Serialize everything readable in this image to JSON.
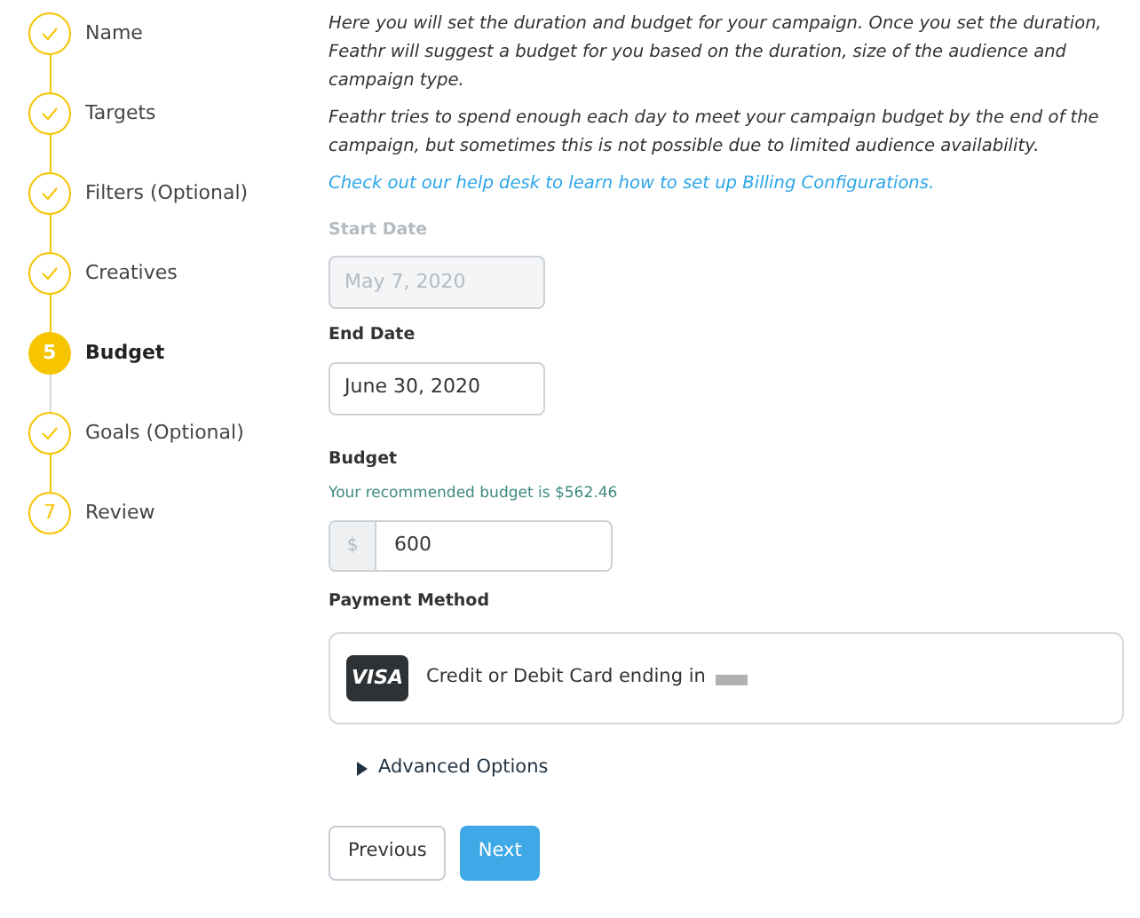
{
  "steps": [
    {
      "label": "Name",
      "kind": "done"
    },
    {
      "label": "Targets",
      "kind": "done"
    },
    {
      "label": "Filters (Optional)",
      "kind": "done"
    },
    {
      "label": "Creatives",
      "kind": "done"
    },
    {
      "label": "Budget",
      "kind": "current",
      "number": "5"
    },
    {
      "label": "Goals (Optional)",
      "kind": "done"
    },
    {
      "label": "Review",
      "kind": "pending",
      "number": "7"
    }
  ],
  "intro": [
    "Here you will set the duration and budget for your campaign. Once you set the duration, Feathr will suggest a budget for you based on the duration, size of the audience and campaign type.",
    "Feathr tries to spend enough each day to meet your campaign budget by the end of the campaign, but sometimes this is not possible due to limited audience availability."
  ],
  "help_link": "Check out our help desk to learn how to set up Billing Configurations.",
  "start_date": {
    "label": "Start Date",
    "value": "May 7, 2020",
    "disabled": true
  },
  "end_date": {
    "label": "End Date",
    "value": "June 30, 2020",
    "disabled": false
  },
  "budget": {
    "label": "Budget",
    "hint": "Your recommended budget is $562.46",
    "prefix": "$",
    "value": "600"
  },
  "payment": {
    "label": "Payment Method",
    "card_brand": "VISA",
    "card_text": "Credit or Debit Card ending in"
  },
  "advanced": {
    "label": "Advanced Options",
    "expanded": false
  },
  "buttons": [
    {
      "label": "Previous",
      "kind": "secondary"
    },
    {
      "label": "Next",
      "kind": "primary"
    }
  ]
}
